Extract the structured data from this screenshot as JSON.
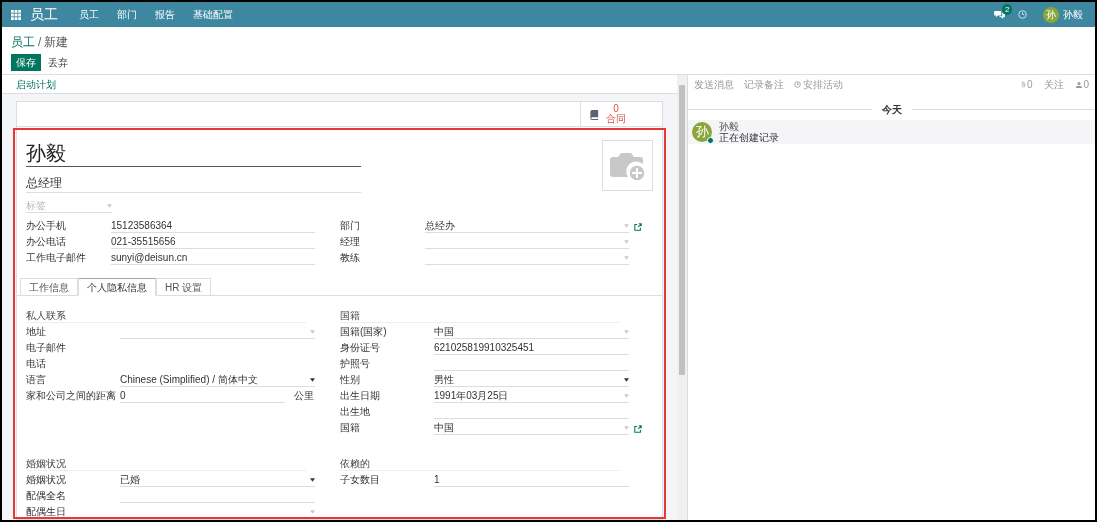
{
  "navbar": {
    "app_title": "员工",
    "menus": [
      "员工",
      "部门",
      "报告",
      "基础配置"
    ],
    "message_count": "2",
    "user": {
      "initial": "孙",
      "name": "孙毅"
    }
  },
  "breadcrumb": {
    "parent": "员工",
    "separator": "/",
    "current": "新建"
  },
  "buttons": {
    "save": "保存",
    "discard": "丢弃"
  },
  "statusbar": {
    "action": "启动计划"
  },
  "stat_button": {
    "value": "0",
    "label": "合同"
  },
  "employee": {
    "name": "孙毅",
    "job_title": "总经理",
    "tags_placeholder": "标签"
  },
  "main_fields": [
    [
      {
        "label": "办公手机",
        "value": "15123586364",
        "kind": "text"
      },
      {
        "label": "办公电话",
        "value": "021-35515656",
        "kind": "text"
      },
      {
        "label": "工作电子邮件",
        "value": "sunyi@deisun.cn",
        "kind": "text"
      }
    ],
    [
      {
        "label": "部门",
        "value": "总经办",
        "kind": "many2one",
        "link": true
      },
      {
        "label": "经理",
        "kind": "many2one"
      },
      {
        "label": "教练",
        "kind": "many2one"
      }
    ]
  ],
  "tabs": [
    {
      "label": "工作信息",
      "selected": false
    },
    {
      "label": "个人隐私信息",
      "selected": true
    },
    {
      "label": "HR 设置",
      "selected": false
    }
  ],
  "tab_groups": [
    [
      {
        "title": "私人联系",
        "fields": [
          {
            "label": "地址",
            "kind": "many2one"
          },
          {
            "label": "电子邮件",
            "kind": "readonly"
          },
          {
            "label": "电话",
            "kind": "readonly"
          },
          {
            "label": "语言",
            "value": "Chinese (Simplified) / 简体中文",
            "kind": "select"
          },
          {
            "label": "家和公司之间的距离",
            "value": "0",
            "kind": "text",
            "unit": "公里"
          }
        ]
      },
      {
        "title": "婚姻状况",
        "fields": [
          {
            "label": "婚姻状况",
            "value": "已婚",
            "kind": "select"
          },
          {
            "label": "配偶全名",
            "kind": "text"
          },
          {
            "label": "配偶生日",
            "kind": "many2one"
          }
        ]
      }
    ],
    [
      {
        "title": "国籍",
        "fields": [
          {
            "label": "国籍(国家)",
            "value": "中国",
            "kind": "many2one"
          },
          {
            "label": "身份证号",
            "value": "621025819910325451",
            "kind": "text"
          },
          {
            "label": "护照号",
            "kind": "text"
          },
          {
            "label": "性别",
            "value": "男性",
            "kind": "select"
          },
          {
            "label": "出生日期",
            "value": "1991年03月25日",
            "kind": "many2one"
          },
          {
            "label": "出生地",
            "kind": "text"
          },
          {
            "label": "国籍",
            "value": "中国",
            "kind": "many2one",
            "link": true
          }
        ]
      },
      {
        "title": "依赖的",
        "fields": [
          {
            "label": "子女数目",
            "value": "1",
            "kind": "text"
          }
        ]
      }
    ]
  ],
  "chatter": {
    "actions": [
      "发送消息",
      "记录备注",
      "安排活动"
    ],
    "attachments": "0",
    "follow": "关注",
    "followers": "0",
    "date_separator": "今天",
    "messages": [
      {
        "initial": "孙",
        "author": "孙毅",
        "body": "正在创建记录",
        "online": true
      }
    ]
  }
}
